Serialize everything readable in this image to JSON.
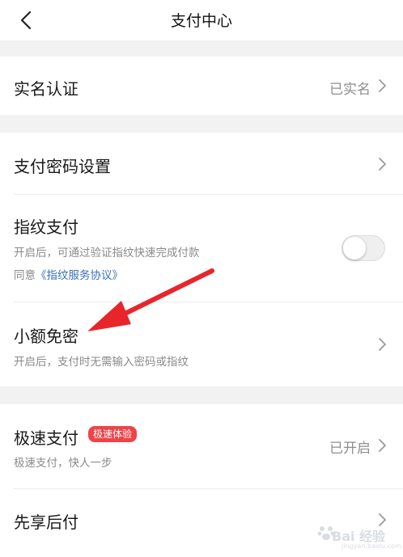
{
  "header": {
    "title": "支付中心"
  },
  "rows": {
    "real_name": {
      "label": "实名认证",
      "status": "已实名"
    },
    "pay_password": {
      "label": "支付密码设置"
    },
    "fingerprint": {
      "label": "指纹支付",
      "desc": "开启后，可通过验证指纹快速完成付款",
      "agree_prefix": "同意",
      "agree_link": "《指纹服务协议》",
      "toggle_on": false
    },
    "small_free": {
      "label": "小额免密",
      "desc": "开启后，支付时无需输入密码或指纹"
    },
    "express_pay": {
      "label": "极速支付",
      "badge": "极速体验",
      "desc": "极速支付，快人一步",
      "status": "已开启"
    },
    "pay_later": {
      "label": "先享后付"
    }
  },
  "watermark": {
    "text": "Bai 经验",
    "sub": "jingyan.baidu.com"
  },
  "colors": {
    "background": "#f2f2f2",
    "card": "#ffffff",
    "link": "#3b6fb6",
    "badge": "#ee4449",
    "annotation_arrow": "#e8252b"
  },
  "icons": {
    "back": "chevron-left-icon",
    "row_arrow": "chevron-right-icon"
  }
}
